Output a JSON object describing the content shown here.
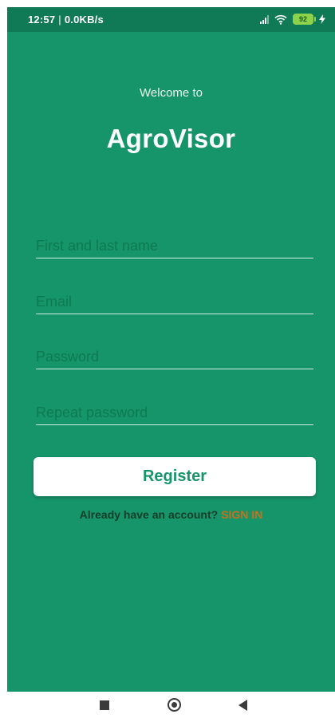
{
  "status_bar": {
    "time": "12:57",
    "separator": "|",
    "network_speed": "0.0KB/s",
    "icons": [
      "signal-icon",
      "wifi-icon",
      "battery-icon",
      "charging-bolt-icon"
    ],
    "battery_level": "92"
  },
  "header": {
    "welcome_text": "Welcome to",
    "app_name": "AgroVisor"
  },
  "form": {
    "name_placeholder": "First and last name",
    "name_value": "",
    "email_placeholder": "Email",
    "email_value": "",
    "password_placeholder": "Password",
    "password_value": "",
    "repeat_password_placeholder": "Repeat password",
    "repeat_password_value": ""
  },
  "actions": {
    "register_label": "Register",
    "signin_prompt": "Already have an account?",
    "signin_link": "SIGN IN"
  },
  "nav_bar": {
    "icons": [
      "recents-square-icon",
      "home-circle-icon",
      "back-triangle-icon"
    ]
  },
  "colors": {
    "background": "#17956a",
    "status_bar": "#0f7a55",
    "signin_link": "#c8701c",
    "button": "#ffffff"
  }
}
